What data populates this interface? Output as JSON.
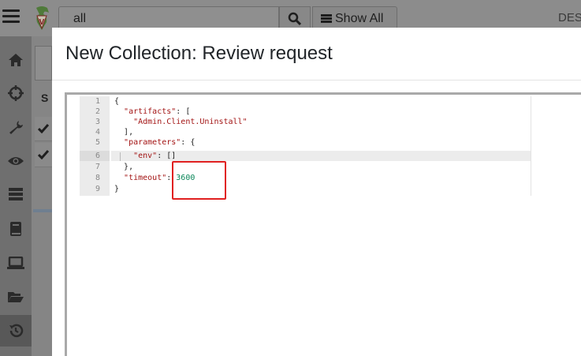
{
  "header": {
    "search_value": "all",
    "show_all_label": "Show All",
    "right_text": "DES"
  },
  "sidebar": {
    "items": [
      {
        "icon": "home-icon"
      },
      {
        "icon": "crosshair-icon"
      },
      {
        "icon": "wrench-icon"
      },
      {
        "icon": "eye-icon"
      },
      {
        "icon": "server-icon"
      },
      {
        "icon": "book-icon"
      },
      {
        "icon": "laptop-icon"
      },
      {
        "icon": "folder-open-icon"
      },
      {
        "icon": "history-icon"
      }
    ]
  },
  "background_list": {
    "column_letter": "S"
  },
  "modal": {
    "title": "New Collection: Review request",
    "line_numbers": [
      "1",
      "2",
      "3",
      "4",
      "5",
      "6",
      "7",
      "8",
      "9"
    ],
    "code_lines": [
      {
        "a": "{",
        "b": "",
        "c": ""
      },
      {
        "a": "  ",
        "b": "\"artifacts\"",
        "c": ": ["
      },
      {
        "a": "    ",
        "b": "\"Admin.Client.Uninstall\"",
        "c": ""
      },
      {
        "a": "  ",
        "b": "",
        "c": "],"
      },
      {
        "a": "  ",
        "b": "\"parameters\"",
        "c": ": {"
      },
      {
        "a": "    ",
        "b": "\"env\"",
        "c": ": []"
      },
      {
        "a": "  ",
        "b": "",
        "c": "},"
      },
      {
        "a": "  ",
        "b": "\"timeout\"",
        "c": ": "
      },
      {
        "a": "}",
        "b": "",
        "c": ""
      }
    ],
    "timeout_value": "3600"
  },
  "colors": {
    "key": "#a31515",
    "number": "#098658",
    "highlight_box": "#e02020"
  }
}
